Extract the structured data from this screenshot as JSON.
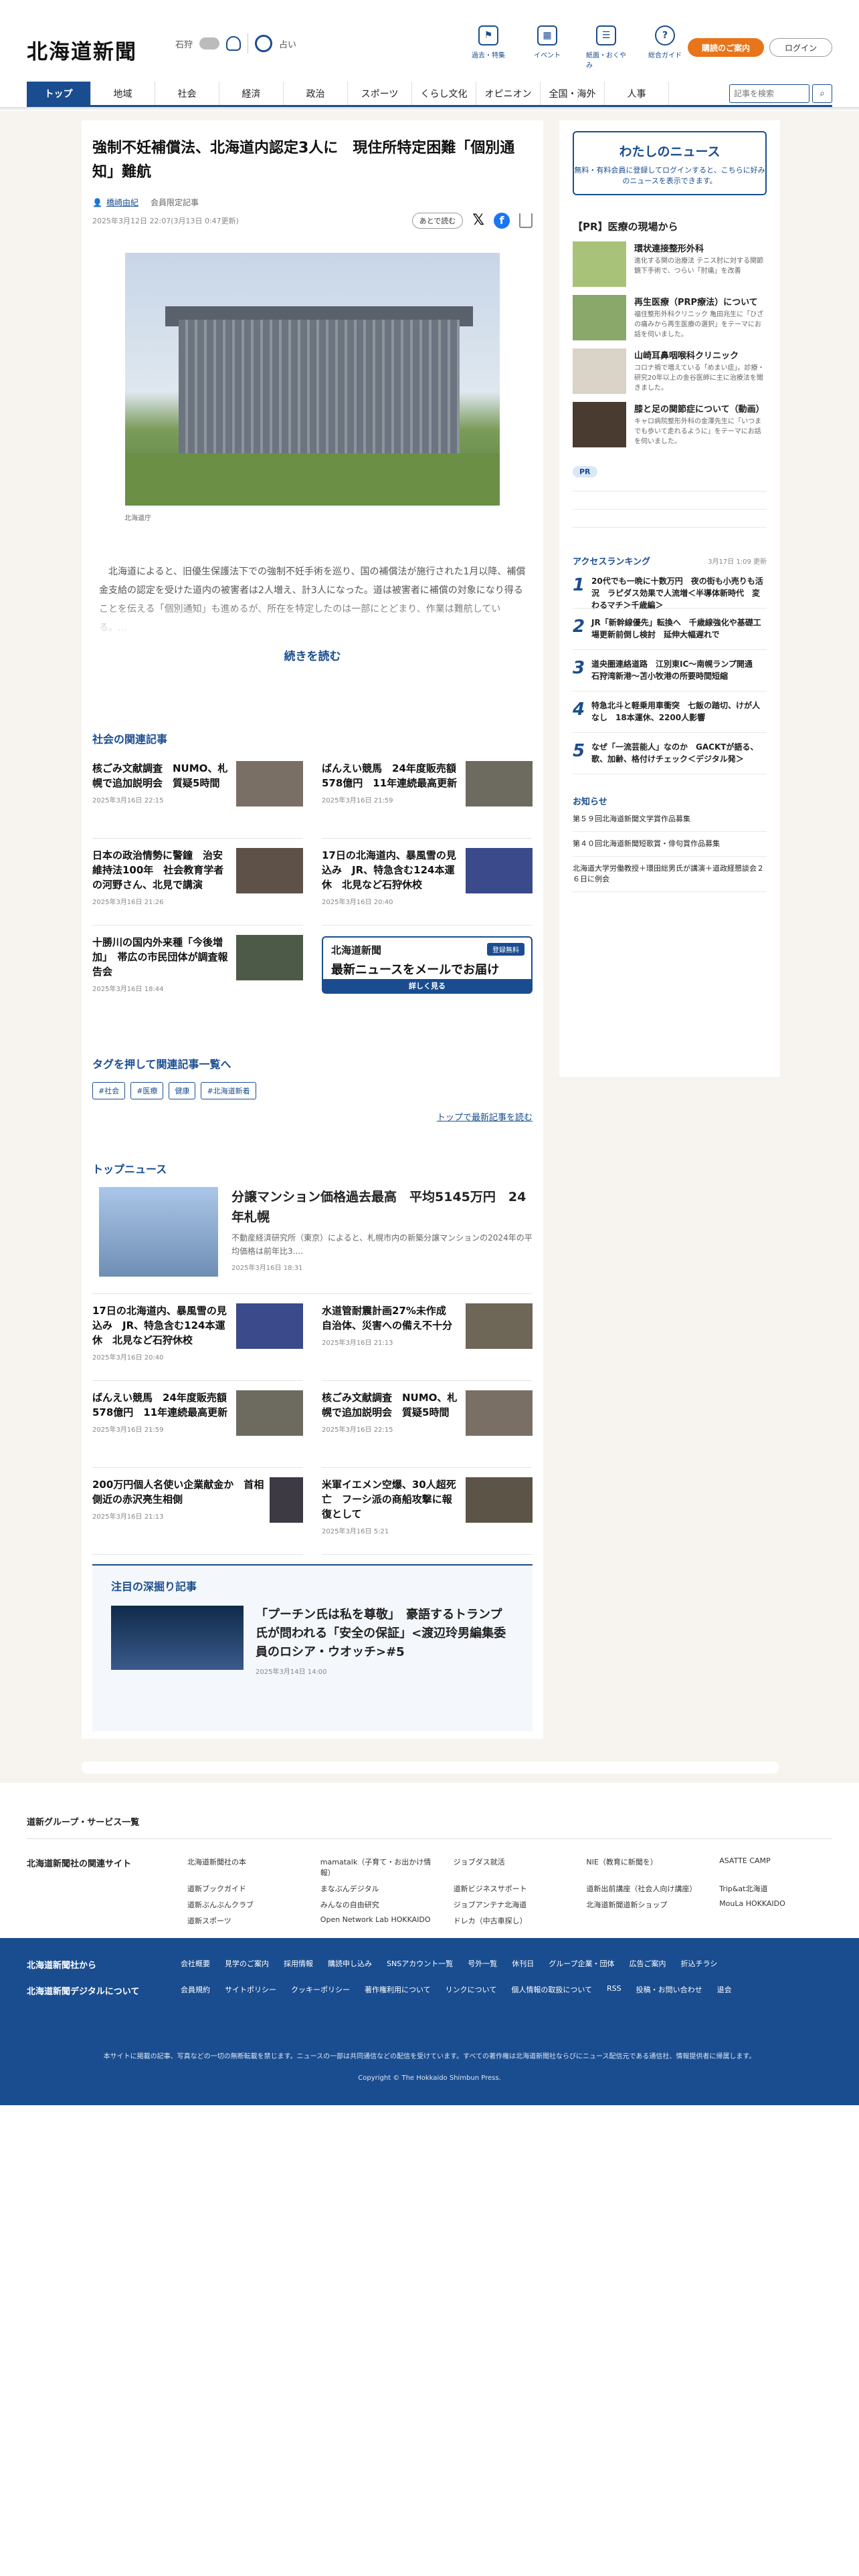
{
  "header": {
    "logo": "北海道新聞",
    "weather_city": "石狩",
    "weather_sub": "占い",
    "icons": [
      {
        "label": "過去・特集",
        "icon": "flag-icon"
      },
      {
        "label": "イベント",
        "icon": "calendar-icon"
      },
      {
        "label": "紙面・おくやみ",
        "icon": "newspaper-icon"
      },
      {
        "label": "総合ガイド",
        "icon": "help-icon"
      }
    ],
    "subscribe": "購読のご案内",
    "login": "ログイン"
  },
  "nav": {
    "items": [
      "トップ",
      "地域",
      "社会",
      "経済",
      "政治",
      "スポーツ",
      "くらし文化",
      "オピニオン",
      "全国・海外",
      "人事"
    ],
    "search_placeholder": "記事を検索"
  },
  "article": {
    "title": "強制不妊補償法、北海道内認定3人に　現住所特定困難「個別通知」難航",
    "author": "橋崎由紀",
    "member": "会員限定記事",
    "date": "2025年3月12日 22:07(3月13日 0:47更新)",
    "later": "あとで読む",
    "caption": "北海道庁",
    "lead": "北海道によると、旧優生保護法下での強制不妊手術を巡り、国の補償法が施行された1月以降、補償金支給の認定を受けた道内の被害者は2人増え、計3人になった。道は被害者に補償の対象になり得ることを伝える「個別通知」も進めるが、所在を特定したのは一部にとどまり、作業は難航している。...",
    "readmore": "続きを読む"
  },
  "related": {
    "title": "社会の関連記事",
    "items": [
      {
        "title": "核ごみ文献調査　NUMO、札幌で追加説明会　質疑5時間",
        "date": "2025年3月16日 22:15"
      },
      {
        "title": "ばんえい競馬　24年度販売額578億円　11年連続最高更新",
        "date": "2025年3月16日 21:59"
      },
      {
        "title": "日本の政治情勢に警鐘　治安維持法100年　社会教育学者の河野さん、北見で講演",
        "date": "2025年3月16日 21:26"
      },
      {
        "title": "17日の北海道内、暴風雪の見込み　JR、特急含む124本運休　北見など石狩休校",
        "date": "2025年3月16日 20:40"
      },
      {
        "title": "十勝川の国内外来種「今後増加」　帯広の市民団体が調査報告会",
        "date": "2025年3月16日 18:44"
      }
    ],
    "promo": {
      "logo": "北海道新聞",
      "tag": "登録無料",
      "headline": "最新ニュースをメールでお届け",
      "button": "詳しく見る"
    }
  },
  "tags": {
    "title": "タグを押して関連記事一覧へ",
    "items": [
      "#社会",
      "#医療",
      "健康",
      "#北海道新着"
    ],
    "toplink": "トップで最新記事を読む"
  },
  "topnews": {
    "title": "トップニュース",
    "feature": {
      "title": "分譲マンション価格過去最高　平均5145万円　24年札幌",
      "summary": "不動産経済研究所（東京）によると、札幌市内の新築分譲マンションの2024年の平均価格は前年比3....",
      "date": "2025年3月16日 18:31"
    },
    "items": [
      {
        "title": "17日の北海道内、暴風雪の見込み　JR、特急含む124本運休　北見など石狩休校",
        "date": "2025年3月16日 20:40"
      },
      {
        "title": "水道管耐震計画27%未作成　自治体、災害への備え不十分",
        "date": "2025年3月16日 21:13"
      },
      {
        "title": "ばんえい競馬　24年度販売額578億円　11年連続最高更新",
        "date": "2025年3月16日 21:59"
      },
      {
        "title": "核ごみ文献調査　NUMO、札幌で追加説明会　質疑5時間",
        "date": "2025年3月16日 22:15"
      },
      {
        "title": "200万円個人名使い企業献金か　首相側近の赤沢亮生相側",
        "date": "2025年3月16日 21:13"
      },
      {
        "title": "米軍イエメン空爆、30人超死亡　フーシ派の商船攻撃に報復として",
        "date": "2025年3月16日 5:21"
      }
    ]
  },
  "deep": {
    "title": "注目の深掘り記事",
    "headline": "「プーチン氏は私を尊敬」　豪語するトランプ氏が問われる「安全の保証」<渡辺玲男編集委員のロシア・ウオッチ>#5",
    "date": "2025年3月14日 14:00"
  },
  "side": {
    "mynews_title": "わたしのニュース",
    "mynews_text": "無料・有料会員に登録してログインすると、こちらに好みのニュースを表示できます。",
    "pr_title": "【PR】医療の現場から",
    "pr_items": [
      {
        "title": "環状連接整形外科",
        "text": "進化する関の治療法 テニス肘に対する関節鏡下手術で、つらい「肘痛」を改善"
      },
      {
        "title": "再生医療（PRP療法）について",
        "text": "福住整形外科クリニック 亀田兆生に「ひざの痛みから再生医療の選択」をテーマにお話を伺いました。"
      },
      {
        "title": "山崎耳鼻咽喉科クリニック",
        "text": "コロナ禍で増えている「めまい症」。診療・研究20年以上の金谷医師に主に治療法を聞きました。"
      },
      {
        "title": "膝と足の関節症について（動画）",
        "text": "キャロ病院整形外科の金澤先生に「いつまでも歩いて走れるように」をテーマにお話を伺いました。"
      }
    ],
    "pr_badge": "PR",
    "ranking_title": "アクセスランキング",
    "ranking_date": "3月17日 1:09 更新",
    "ranking": [
      "20代でも一晩に十数万円　夜の街も小売りも活況　ラピダス効果で人流増＜半導体新時代　変わるマチ＞千歳編＞",
      "JR「新幹線優先」転換へ　千歳線強化や基礎工場更新前倒し検討　延伸大幅遅れで",
      "道央圏連絡道路　江別東IC～南幌ランプ開通　石狩湾新港～苫小牧港の所要時間短縮",
      "特急北斗と軽乗用車衝突　七飯の踏切、けが人なし　18本運休、2200人影響",
      "なぜ「一流芸能人」なのか　GACKTが語る、歌、加齢、格付けチェック＜デジタル発＞"
    ],
    "notice_title": "お知らせ",
    "notices": [
      "第５９回北海道新聞文学賞作品募集",
      "第４０回北海道新聞短歌賞・俳句賞作品募集",
      "北海道大学労働教授＋環田総男氏が講演＋道政経懇談会２６日に例会"
    ]
  },
  "footer": {
    "group_title": "道新グループ・サービス一覧",
    "group_label": "北海道新聞社の関連サイト",
    "group_links": [
      "北海道新聞社の本",
      "mamatalk（子育て・お出かけ情報）",
      "ジョブダス就活",
      "NIE（教育に新聞を）",
      "ASATTE CAMP",
      "道新ブックガイド",
      "まなぶんデジタル",
      "道新ビジネスサポート",
      "道新出前講座（社会人向け講座）",
      "Trip&at北海道",
      "道新ぶんぶんクラブ",
      "みんなの自由研究",
      "ジョブアンテナ北海道",
      "北海道新聞道新ショップ",
      "MouLa HOKKAIDO",
      "道新スポーツ",
      "Open Network Lab HOKKAIDO",
      "ドレカ（中古車探し）"
    ],
    "blue_label1": "北海道新聞社から",
    "blue_links1": [
      "会社概要",
      "見学のご案内",
      "採用情報",
      "購読申し込み",
      "SNSアカウント一覧",
      "号外一覧",
      "休刊日",
      "グループ企業・団体",
      "広告ご案内",
      "折込チラシ"
    ],
    "blue_label2": "北海道新聞デジタルについて",
    "blue_links2": [
      "会員規約",
      "サイトポリシー",
      "クッキーポリシー",
      "著作権利用について",
      "リンクについて",
      "個人情報の取扱について",
      "RSS",
      "投稿・お問い合わせ",
      "退会"
    ],
    "note": "本サイトに掲載の記事、写真などの一切の無断転載を禁じます。ニュースの一部は共同通信などの配信を受けています。すべての著作権は北海道新聞社ならびにニュース配信元である通信社、情報提供者に帰属します。",
    "copyright": "Copyright © The Hokkaido Shimbun Press."
  }
}
